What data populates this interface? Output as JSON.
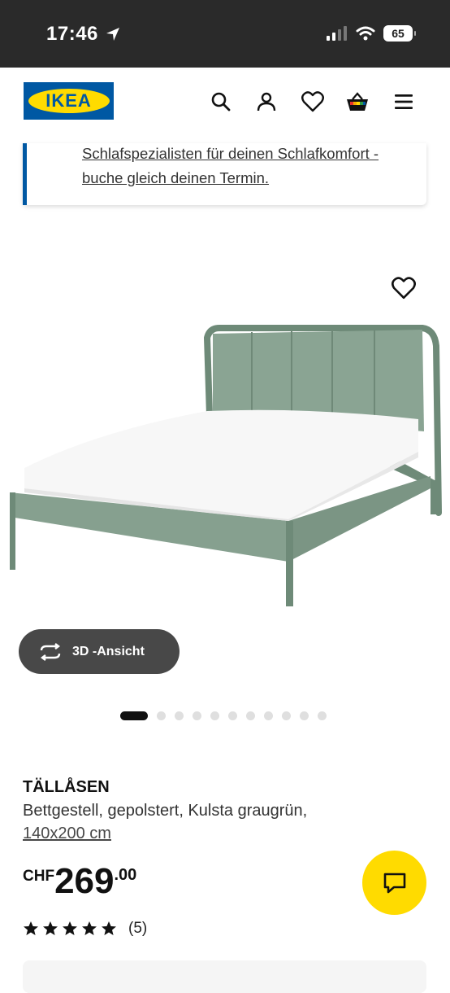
{
  "status_bar": {
    "time": "17:46",
    "battery": "65"
  },
  "header": {
    "logo_text": "IKEA",
    "icons": [
      "search-icon",
      "user-icon",
      "heart-icon",
      "cart-icon",
      "menu-icon"
    ]
  },
  "notice": {
    "text": "Schlafspezialisten für deinen Schlafkomfort - buche gleich deinen Termin."
  },
  "gallery": {
    "view_3d_label": "3D -Ansicht",
    "dot_count": 11,
    "active_dot": 0
  },
  "product": {
    "name": "TÄLLÅSEN",
    "description": "Bettgestell, gepolstert, Kulsta graugrün,",
    "size": "140x200 cm",
    "currency": "CHF",
    "price_int": "269",
    "price_dec": ".00",
    "rating": 5,
    "reviews": "(5)"
  },
  "colors": {
    "brand_blue": "#0058a3",
    "brand_yellow": "#ffdb00",
    "bed_green": "#7f9a88"
  }
}
